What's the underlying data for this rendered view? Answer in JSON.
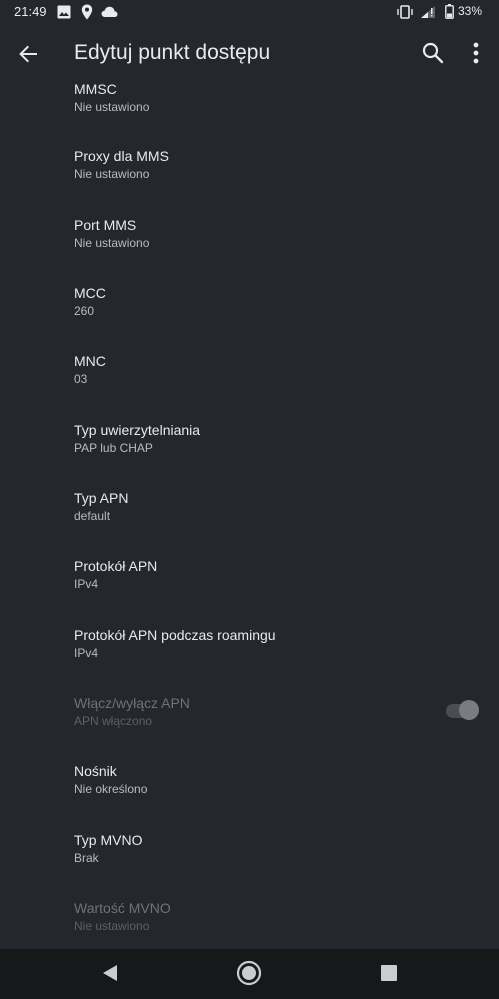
{
  "status_bar": {
    "time": "21:49",
    "battery": "33%",
    "left_icons": [
      "image-icon",
      "location-icon",
      "cloud-icon"
    ],
    "right_icons": [
      "vibrate-icon",
      "signal-icon",
      "battery-icon"
    ]
  },
  "toolbar": {
    "title": "Edytuj punkt dostępu",
    "back_icon": "arrow-back-icon",
    "search_icon": "search-icon",
    "more_icon": "more-vert-icon"
  },
  "settings": [
    {
      "title": "MMSC",
      "summary": "Nie ustawiono",
      "enabled": true
    },
    {
      "title": "Proxy dla MMS",
      "summary": "Nie ustawiono",
      "enabled": true
    },
    {
      "title": "Port MMS",
      "summary": "Nie ustawiono",
      "enabled": true
    },
    {
      "title": "MCC",
      "summary": "260",
      "enabled": true
    },
    {
      "title": "MNC",
      "summary": "03",
      "enabled": true
    },
    {
      "title": "Typ uwierzytelniania",
      "summary": "PAP lub CHAP",
      "enabled": true
    },
    {
      "title": "Typ APN",
      "summary": "default",
      "enabled": true
    },
    {
      "title": "Protokół APN",
      "summary": "IPv4",
      "enabled": true
    },
    {
      "title": "Protokół APN podczas roamingu",
      "summary": "IPv4",
      "enabled": true
    },
    {
      "title": "Włącz/wyłącz APN",
      "summary": "APN włączono",
      "enabled": false,
      "toggle_on": true
    },
    {
      "title": "Nośnik",
      "summary": "Nie określono",
      "enabled": true
    },
    {
      "title": "Typ MVNO",
      "summary": "Brak",
      "enabled": true
    },
    {
      "title": "Wartość MVNO",
      "summary": "Nie ustawiono",
      "enabled": false
    }
  ],
  "navbar": {
    "back_icon": "nav-back-icon",
    "home_icon": "nav-home-icon",
    "recents_icon": "nav-recents-icon"
  },
  "colors": {
    "background": "#24272b",
    "text_primary": "#e8eaed",
    "text_secondary": "#b8bcc2",
    "text_disabled": "#6e7379",
    "navbar": "#16181a"
  }
}
